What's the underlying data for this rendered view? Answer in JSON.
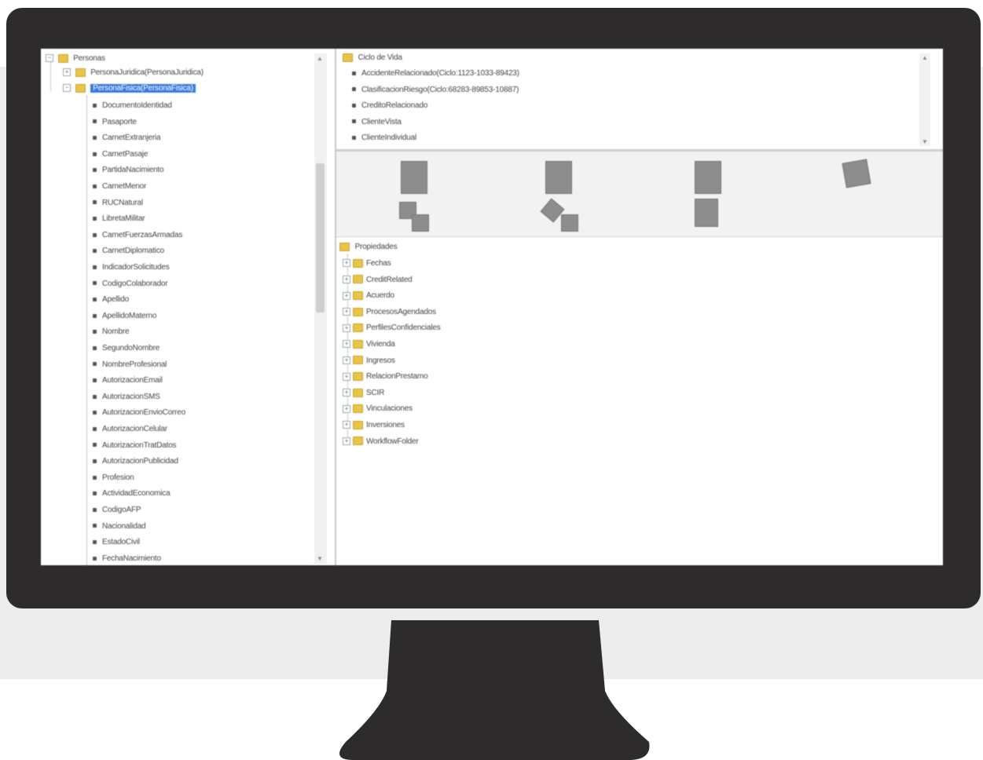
{
  "tree": {
    "root_label": "Personas",
    "items": [
      {
        "label": "PersonaJuridica(PersonaJuridica)",
        "selected": false
      },
      {
        "label": "PersonaFisica(PersonaFisica)",
        "selected": true
      }
    ],
    "leaves": [
      "DocumentoIdentidad",
      "Pasaporte",
      "CarnetExtranjeria",
      "CarnetPasaje",
      "PartidaNacimiento",
      "CarnetMenor",
      "RUCNatural",
      "LibretaMilitar",
      "CarnetFuerzasArmadas",
      "CarnetDiplomatico",
      "IndicadorSolicitudes",
      "CodigoColaborador",
      "Apellido",
      "ApellidoMaterno",
      "Nombre",
      "SegundoNombre",
      "NombreProfesional",
      "AutorizacionEmail",
      "AutorizacionSMS",
      "AutorizacionEnvioCorreo",
      "AutorizacionCelular",
      "AutorizacionTratDatos",
      "AutorizacionPublicidad",
      "Profesion",
      "ActividadEconomica",
      "CodigoAFP",
      "Nacionalidad",
      "EstadoCivil",
      "FechaNacimiento"
    ]
  },
  "list": {
    "header": "Ciclo de Vida",
    "rows": [
      "AccidenteRelacionado(Ciclo:1123-1033-89423)",
      "ClasificacionRiesgo(Ciclo:68283-89853-10887)",
      "CreditoRelacionado",
      "ClienteVista",
      "ClienteIndividual"
    ]
  },
  "properties": {
    "header": "Propiedades",
    "items": [
      "Fechas",
      "CreditRelated",
      "Acuerdo",
      "ProcesosAgendados",
      "PerfilesConfidenciales",
      "Vivienda",
      "Ingresos",
      "RelacionPrestamo",
      "SCIR",
      "Vinculaciones",
      "Inversiones",
      "WorkflowFolder"
    ]
  },
  "colors": {
    "bezel": "#2d2b2b",
    "selection": "#3a7be0",
    "folder": "#e8c547"
  }
}
